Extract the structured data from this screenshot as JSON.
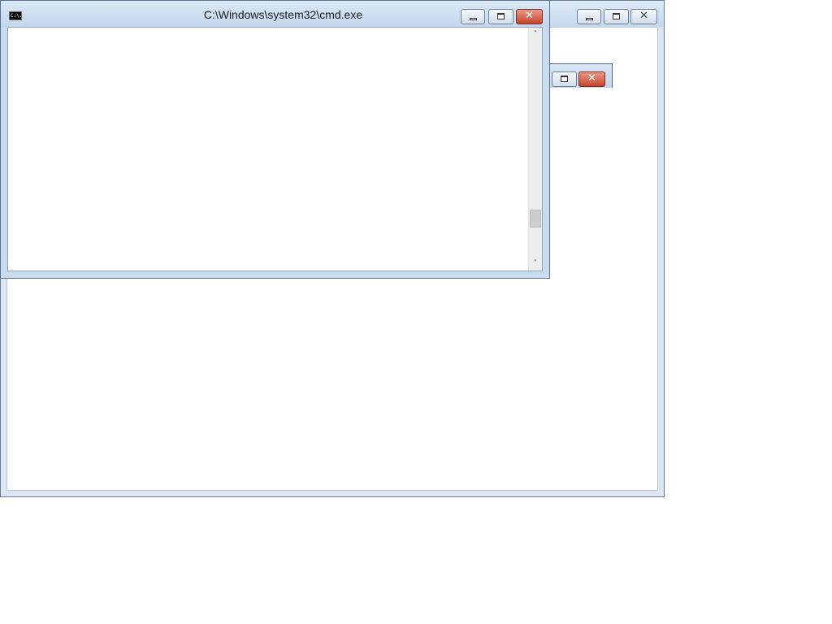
{
  "cmd_window": {
    "title": "C:\\Windows\\system32\\cmd.exe",
    "icon": "cmd-app-icon",
    "icon_text": "C:\\.",
    "scroll_up_glyph": "˄",
    "scroll_down_glyph": "˅"
  },
  "close_glyph": "✕"
}
